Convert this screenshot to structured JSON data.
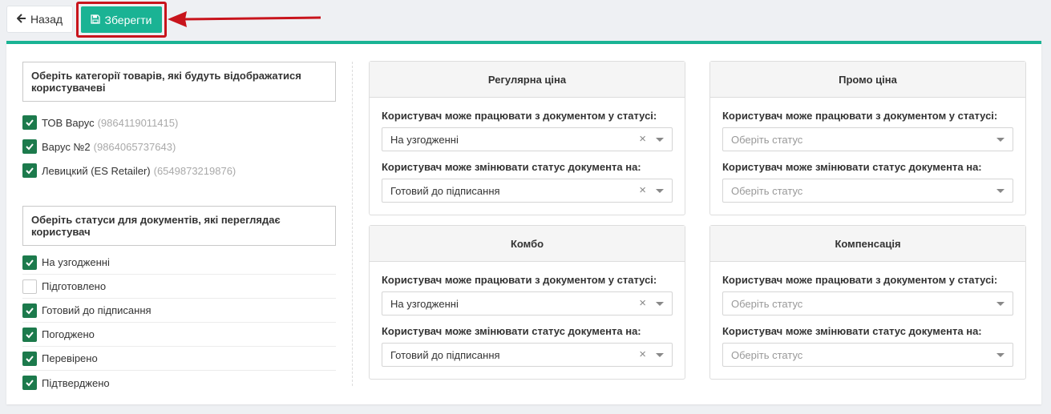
{
  "toolbar": {
    "back_label": "Назад",
    "save_label": "Зберегти"
  },
  "colors": {
    "accent": "#1ab394",
    "checkbox_checked": "#1c7a4c",
    "highlight": "#c8141c"
  },
  "categories": {
    "title": "Оберіть категорії товарів, які будуть відображатися користувачеві",
    "items": [
      {
        "name": "ТОВ Варус",
        "code": "(9864119011415)",
        "checked": true
      },
      {
        "name": "Варус №2",
        "code": "(9864065737643)",
        "checked": true
      },
      {
        "name": "Левицкий (ES Retailer)",
        "code": "(6549873219876)",
        "checked": true
      }
    ]
  },
  "statuses": {
    "title": "Оберіть статуси для документів, які переглядає користувач",
    "items": [
      {
        "label": "На узгодженні",
        "checked": true
      },
      {
        "label": "Підготовлено",
        "checked": false
      },
      {
        "label": "Готовий до підписання",
        "checked": true
      },
      {
        "label": "Погоджено",
        "checked": true
      },
      {
        "label": "Перевірено",
        "checked": true
      },
      {
        "label": "Підтверджено",
        "checked": true
      }
    ]
  },
  "cards": {
    "regular": {
      "title": "Регулярна ціна",
      "label1": "Користувач може працювати з документом у статусі:",
      "value1": "На узгодженні",
      "label2": "Користувач може змінювати статус документа на:",
      "value2": "Готовий до підписання"
    },
    "promo": {
      "title": "Промо ціна",
      "label1": "Користувач може працювати з документом у статусі:",
      "placeholder1": "Оберіть статус",
      "label2": "Користувач може змінювати статус документа на:",
      "placeholder2": "Оберіть статус"
    },
    "combo": {
      "title": "Комбо",
      "label1": "Користувач може працювати з документом у статусі:",
      "value1": "На узгодженні",
      "label2": "Користувач може змінювати статус документа на:",
      "value2": "Готовий до підписання"
    },
    "compensation": {
      "title": "Компенсація",
      "label1": "Користувач може працювати з документом у статусі:",
      "placeholder1": "Оберіть статус",
      "label2": "Користувач може змінювати статус документа на:",
      "placeholder2": "Оберіть статус"
    }
  },
  "icons": {
    "back": "arrow-left-icon",
    "save": "floppy-disk-icon",
    "clear": "×",
    "dropdown": "caret-down-icon"
  }
}
